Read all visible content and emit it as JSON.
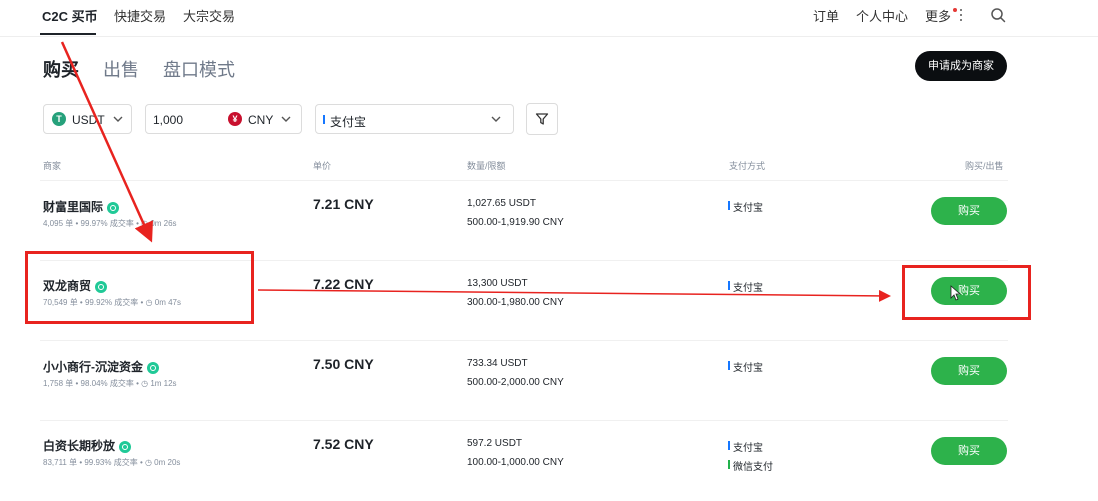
{
  "topnav": {
    "items": [
      "C2C 买币",
      "快捷交易",
      "大宗交易"
    ],
    "right": [
      "订单",
      "个人中心",
      "更多"
    ]
  },
  "tabs": [
    "购买",
    "出售",
    "盘口模式"
  ],
  "merchant_button": "申请成为商家",
  "filters": {
    "coin": "USDT",
    "coin_icon_letter": "T",
    "amount": "1,000",
    "fiat": "CNY",
    "fiat_icon_letter": "¥",
    "payment": "支付宝"
  },
  "table": {
    "headers": [
      "商家",
      "单价",
      "数量/限额",
      "支付方式",
      "购买/出售"
    ],
    "rows": [
      {
        "name": "财富里国际",
        "orders": "4,095 单",
        "rate": "99.97% 成交率",
        "time": "0m 26s",
        "price": "7.21 CNY",
        "quantity": "1,027.65 USDT",
        "limit": "500.00-1,919.90 CNY",
        "payments": [
          "支付宝"
        ],
        "action": "购买"
      },
      {
        "name": "双龙商贸",
        "orders": "70,549 单",
        "rate": "99.92% 成交率",
        "time": "0m 47s",
        "price": "7.22 CNY",
        "quantity": "13,300 USDT",
        "limit": "300.00-1,980.00 CNY",
        "payments": [
          "支付宝"
        ],
        "action": "购买"
      },
      {
        "name": "小小商行-沉淀资金",
        "orders": "1,758 单",
        "rate": "98.04% 成交率",
        "time": "1m 12s",
        "price": "7.50 CNY",
        "quantity": "733.34 USDT",
        "limit": "500.00-2,000.00 CNY",
        "payments": [
          "支付宝"
        ],
        "action": "购买"
      },
      {
        "name": "白资长期秒放",
        "orders": "83,711 单",
        "rate": "99.93% 成交率",
        "time": "0m 20s",
        "price": "7.52 CNY",
        "quantity": "597.2 USDT",
        "limit": "100.00-1,000.00 CNY",
        "payments": [
          "支付宝",
          "微信支付"
        ],
        "action": "购买"
      }
    ]
  },
  "colors": {
    "buy_green": "#2db24b",
    "verified_badge": "#20c997",
    "annotation_red": "#e8231f",
    "usdt_icon": "#26a17b",
    "cny_icon": "#c8102e"
  }
}
